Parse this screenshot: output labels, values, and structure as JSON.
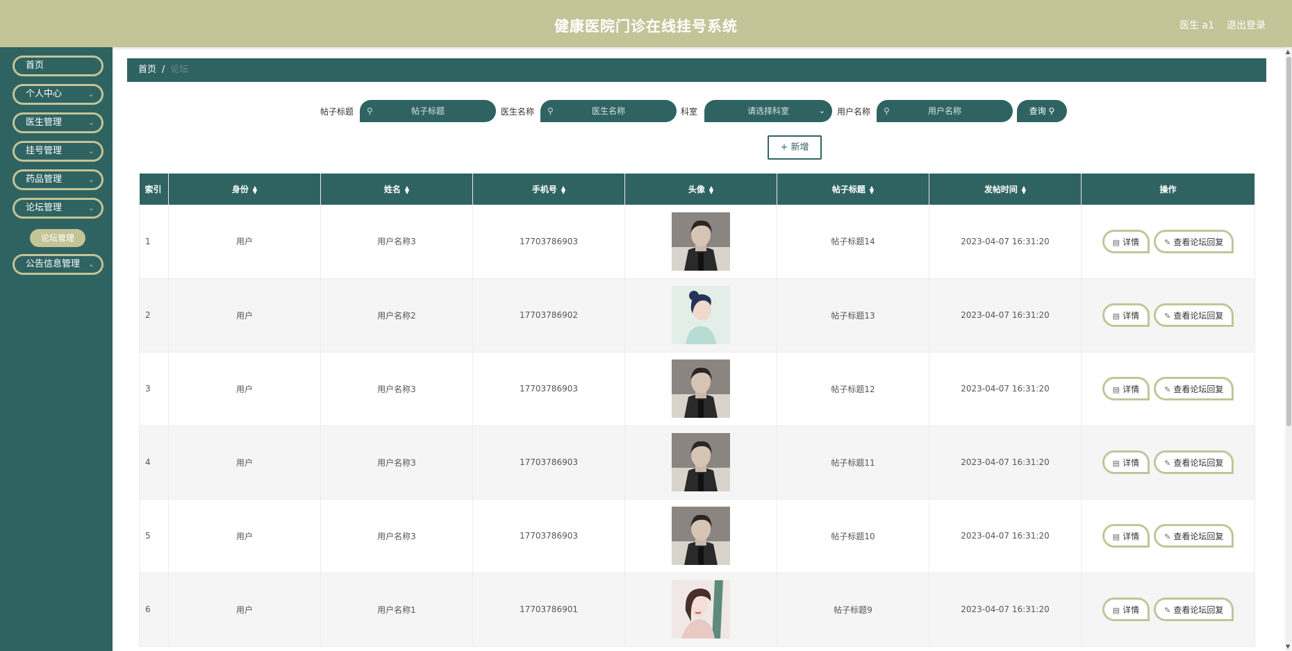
{
  "header": {
    "title": "健康医院门诊在线挂号系统",
    "user": "医生 a1",
    "logout": "退出登录"
  },
  "sidebar": {
    "items": [
      {
        "label": "首页"
      },
      {
        "label": "个人中心",
        "chevron": "chevron-down-icon"
      },
      {
        "label": "医生管理",
        "chevron": "chevron-down-icon"
      },
      {
        "label": "挂号管理",
        "chevron": "chevron-down-icon"
      },
      {
        "label": "药品管理",
        "chevron": "chevron-down-icon"
      },
      {
        "label": "论坛管理",
        "chevron": "chevron-down-icon"
      },
      {
        "label": "公告信息管理",
        "chevron": "chevron-down-icon"
      }
    ],
    "submenu": {
      "label": "论坛管理"
    }
  },
  "breadcrumb": {
    "home": "首页",
    "separator": "/",
    "current": "论坛"
  },
  "search": {
    "title_label": "帖子标题",
    "title_placeholder": "帖子标题",
    "doctor_label": "医生名称",
    "doctor_placeholder": "医生名称",
    "dept_label": "科室",
    "dept_placeholder": "请选择科室",
    "user_label": "用户名称",
    "user_placeholder": "用户名称",
    "button": "查询"
  },
  "add_button": "新增",
  "table": {
    "headers": [
      "索引",
      "身份",
      "姓名",
      "手机号",
      "头像",
      "帖子标题",
      "发帖时间",
      "操作"
    ],
    "rows": [
      {
        "index": "1",
        "identity": "用户",
        "name": "用户名称3",
        "phone": "17703786903",
        "avatar": "male-portrait",
        "post_title": "帖子标题14",
        "time": "2023-04-07 16:31:20"
      },
      {
        "index": "2",
        "identity": "用户",
        "name": "用户名称2",
        "phone": "17703786902",
        "avatar": "female-portrait-blue",
        "post_title": "帖子标题13",
        "time": "2023-04-07 16:31:20"
      },
      {
        "index": "3",
        "identity": "用户",
        "name": "用户名称3",
        "phone": "17703786903",
        "avatar": "male-portrait",
        "post_title": "帖子标题12",
        "time": "2023-04-07 16:31:20"
      },
      {
        "index": "4",
        "identity": "用户",
        "name": "用户名称3",
        "phone": "17703786903",
        "avatar": "male-portrait",
        "post_title": "帖子标题11",
        "time": "2023-04-07 16:31:20"
      },
      {
        "index": "5",
        "identity": "用户",
        "name": "用户名称3",
        "phone": "17703786903",
        "avatar": "male-portrait",
        "post_title": "帖子标题10",
        "time": "2023-04-07 16:31:20"
      },
      {
        "index": "6",
        "identity": "用户",
        "name": "用户名称1",
        "phone": "17703786901",
        "avatar": "female-portrait-illustration",
        "post_title": "帖子标题9",
        "time": "2023-04-07 16:31:20"
      }
    ],
    "actions": {
      "detail": "详情",
      "replies": "查看论坛回复"
    }
  },
  "colors": {
    "header_bg": "#c3c497",
    "sidebar_bg": "#2f6362",
    "accent": "#2f6362",
    "button_border": "#c3c497"
  }
}
